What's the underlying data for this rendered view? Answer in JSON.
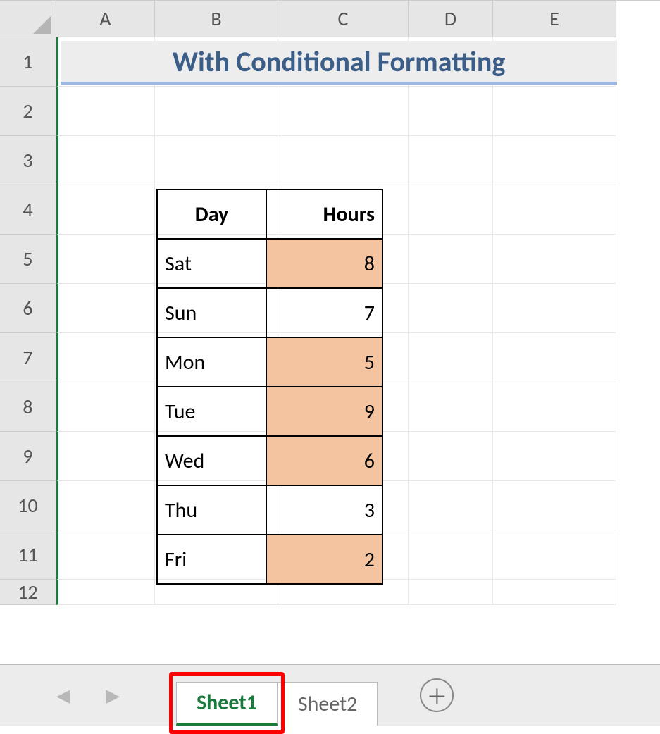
{
  "columns": [
    "A",
    "B",
    "C",
    "D",
    "E"
  ],
  "rows": [
    "1",
    "2",
    "3",
    "4",
    "5",
    "6",
    "7",
    "8",
    "9",
    "10",
    "11",
    "12"
  ],
  "title": "With Conditional Formatting",
  "table": {
    "headers": {
      "day": "Day",
      "hours": "Hours"
    },
    "rows": [
      {
        "day": "Sat",
        "hours": 8,
        "highlight": true
      },
      {
        "day": "Sun",
        "hours": 7,
        "highlight": false
      },
      {
        "day": "Mon",
        "hours": 5,
        "highlight": true
      },
      {
        "day": "Tue",
        "hours": 9,
        "highlight": true
      },
      {
        "day": "Wed",
        "hours": 6,
        "highlight": true
      },
      {
        "day": "Thu",
        "hours": 3,
        "highlight": false
      },
      {
        "day": "Fri",
        "hours": 2,
        "highlight": true
      }
    ]
  },
  "sheets": {
    "active": "Sheet1",
    "list": [
      "Sheet1",
      "Sheet2"
    ]
  },
  "colors": {
    "highlight_fill": "#f4c4a0",
    "title_text": "#3b5e88",
    "title_underline": "#9db7e1",
    "active_tab": "#187a3b"
  },
  "chart_data": {
    "type": "table",
    "title": "With Conditional Formatting",
    "columns": [
      "Day",
      "Hours"
    ],
    "rows": [
      [
        "Sat",
        8
      ],
      [
        "Sun",
        7
      ],
      [
        "Mon",
        5
      ],
      [
        "Tue",
        9
      ],
      [
        "Wed",
        6
      ],
      [
        "Thu",
        3
      ],
      [
        "Fri",
        2
      ]
    ],
    "note": "Hours cells with highlight=true are shaded via conditional formatting"
  }
}
